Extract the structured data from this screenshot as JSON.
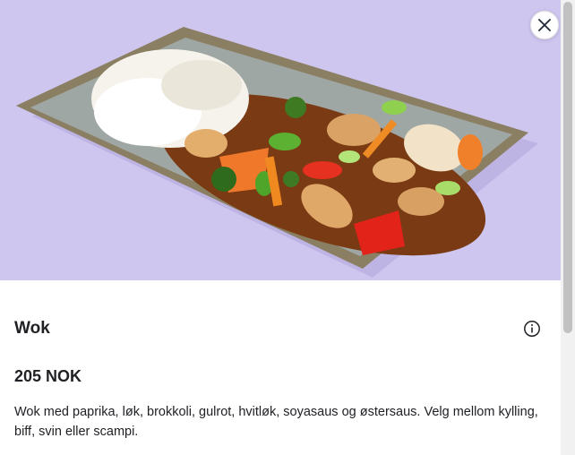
{
  "hero": {
    "image_name": "wok-dish-photo"
  },
  "controls": {
    "close_icon": "close-icon",
    "info_icon": "info-icon"
  },
  "item": {
    "title": "Wok",
    "price": "205 NOK",
    "description": "Wok med paprika, løk, brokkoli, gulrot, hvitløk, soyasaus og østersaus. Velg mellom kylling, biff, svin eller scampi."
  },
  "colors": {
    "hero_background": "#cfc6f0",
    "text": "#202125"
  }
}
